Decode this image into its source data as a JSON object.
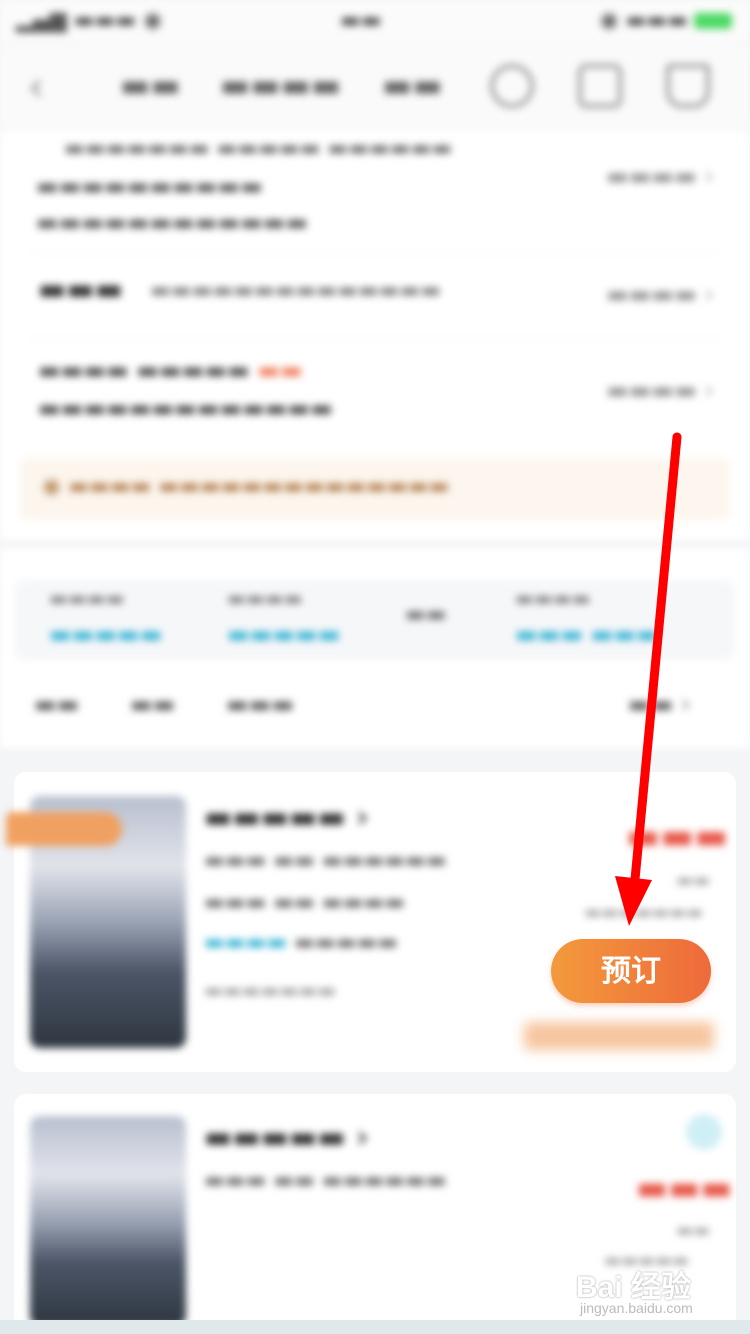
{
  "colors": {
    "book_button": "#ee6a3a",
    "arrow": "#ff0000",
    "price": "#e8584a",
    "blue_tag": "#3fb6d6"
  },
  "booking_card": {
    "book_label": "预订"
  },
  "watermark": {
    "logo_text": "Bai 经验",
    "sub_text": "jingyan.baidu.com"
  },
  "icons": [
    "back-icon",
    "heart-icon",
    "share-icon",
    "filter-icon",
    "paw-icon"
  ]
}
